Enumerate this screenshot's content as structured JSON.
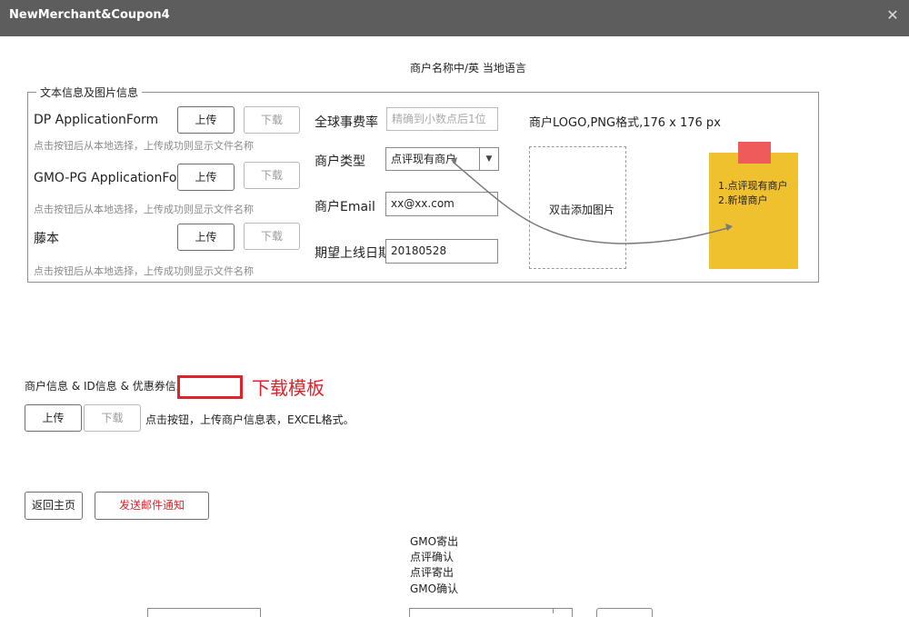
{
  "window": {
    "title": "NewMerchant&Coupon4",
    "close_glyph": "✕"
  },
  "header": {
    "lang_caption": "商户名称中/英 当地语言"
  },
  "group": {
    "legend": "文本信息及图片信息",
    "files": [
      {
        "label": "DP ApplicationForm",
        "upload": "上传",
        "download": "下载",
        "hint": "点击按钮后从本地选择，上传成功则显示文件名称"
      },
      {
        "label": "GMO-PG ApplicationForm",
        "upload": "上传",
        "download": "下载",
        "hint": "点击按钮后从本地选择，上传成功则显示文件名称"
      },
      {
        "label": "藤本",
        "upload": "上传",
        "download": "下载",
        "hint": "点击按钮后从本地选择，上传成功则显示文件名称"
      }
    ],
    "fee_label": "全球事费率",
    "fee_placeholder": "精确到小数点后1位",
    "type_label": "商户类型",
    "type_value": "点评现有商户",
    "type_arrow": "▼",
    "email_label": "商户Email",
    "email_value": "xx@xx.com",
    "date_label": "期望上线日期",
    "date_value": "20180528",
    "logo_caption": "商户LOGO,PNG格式,176 x 176 px",
    "dropzone_text": "双击添加图片"
  },
  "note": {
    "lines": [
      "1.点评现有商户",
      "2.新增商户"
    ]
  },
  "merchant": {
    "label": "商户信息 & ID信息 & 优惠券信息",
    "template_annotation": "下载模板",
    "upload": "上传",
    "download": "下载",
    "hint": "点击按钮，上传商户信息表，EXCEL格式。"
  },
  "actions": {
    "back": "返回主页",
    "send_mail": "发送邮件通知"
  },
  "status_options": [
    "GMO寄出",
    "点评确认",
    "点评寄出",
    "GMO确认"
  ],
  "colors": {
    "titlebar": "#5d5d5d",
    "accent_red": "#e0232b",
    "note_yellow": "#f0c12e",
    "note_pin": "#ef5b5b"
  }
}
